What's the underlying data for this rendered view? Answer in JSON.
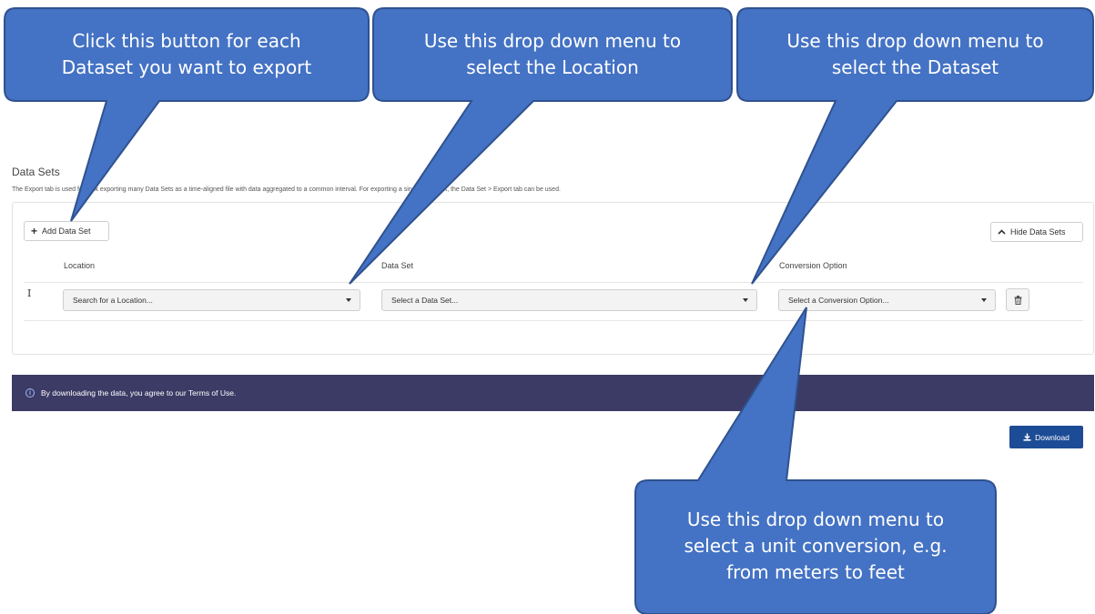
{
  "page": {
    "title": "Data Sets",
    "description": "The Export tab is used for bulk exporting many Data Sets as a time-aligned file with data aggregated to a common interval. For exporting a single Data Set, the Data Set > Export tab can be used."
  },
  "toolbar": {
    "add_label": "Add Data Set",
    "hide_label": "Hide Data Sets"
  },
  "columns": {
    "location": "Location",
    "dataset": "Data Set",
    "conversion": "Conversion Option"
  },
  "row": {
    "location_placeholder": "Search for a Location...",
    "dataset_placeholder": "Select a Data Set...",
    "conversion_placeholder": "Select a Conversion Option..."
  },
  "notice": {
    "text": "By downloading the data, you agree to our Terms of Use."
  },
  "download": {
    "label": "Download"
  },
  "callouts": {
    "add_line1": "Click this button for each",
    "add_line2": "Dataset you want to export",
    "location_line1": "Use this drop down menu to",
    "location_line2": "select the Location",
    "dataset_line1": "Use this drop down menu to",
    "dataset_line2": "select the Dataset",
    "conversion_line1": "Use this drop down menu to",
    "conversion_line2": "select a unit conversion, e.g.",
    "conversion_line3": "from meters to feet"
  },
  "colors": {
    "callout_fill": "#4472c4",
    "callout_stroke": "#2f528f",
    "notice_bar": "#3c3b66",
    "download_button": "#1d4c96"
  },
  "icons": {
    "add": "plus-icon",
    "hide": "chevron-up-icon",
    "drag": "drag-handle-icon",
    "delete": "trash-icon",
    "info": "info-icon",
    "download": "download-icon"
  }
}
